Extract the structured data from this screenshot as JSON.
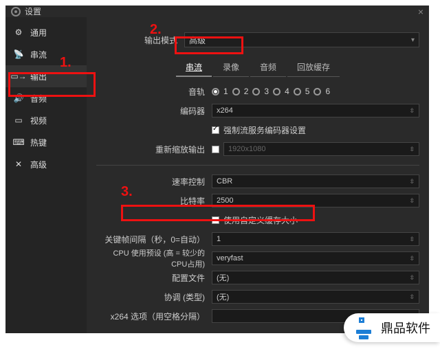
{
  "window": {
    "title": "设置"
  },
  "sidebar": {
    "items": [
      {
        "label": "通用"
      },
      {
        "label": "串流"
      },
      {
        "label": "输出"
      },
      {
        "label": "音频"
      },
      {
        "label": "视频"
      },
      {
        "label": "热键"
      },
      {
        "label": "高级"
      }
    ]
  },
  "mode": {
    "label": "输出模式",
    "value": "高级"
  },
  "tabs": [
    "串流",
    "录像",
    "音频",
    "回放缓存"
  ],
  "fields": {
    "audioTrack": {
      "label": "音轨",
      "options": [
        "1",
        "2",
        "3",
        "4",
        "5",
        "6"
      ],
      "selected": 0
    },
    "encoder": {
      "label": "编码器",
      "value": "x264"
    },
    "enforce": {
      "label": "强制流服务编码器设置",
      "checked": true
    },
    "rescale": {
      "label": "重新缩放输出",
      "checked": false,
      "value": "1920x1080"
    },
    "rateCtrl": {
      "label": "速率控制",
      "value": "CBR"
    },
    "bitrate": {
      "label": "比特率",
      "value": "2500"
    },
    "customBuf": {
      "label": "使用自定义缓存大小",
      "checked": false
    },
    "keyint": {
      "label": "关键帧间隔（秒，0=自动）",
      "value": "1"
    },
    "preset": {
      "label": "CPU 使用预设 (高 = 较少的 CPU占用)",
      "value": "veryfast"
    },
    "profile": {
      "label": "配置文件",
      "value": "(无)"
    },
    "tune": {
      "label": "协调 (类型)",
      "value": "(无)"
    },
    "x264opts": {
      "label": "x264 选项（用空格分隔）",
      "value": ""
    }
  },
  "annotations": {
    "n1": "1.",
    "n2": "2.",
    "n3": "3."
  },
  "watermark": "鼎品软件"
}
